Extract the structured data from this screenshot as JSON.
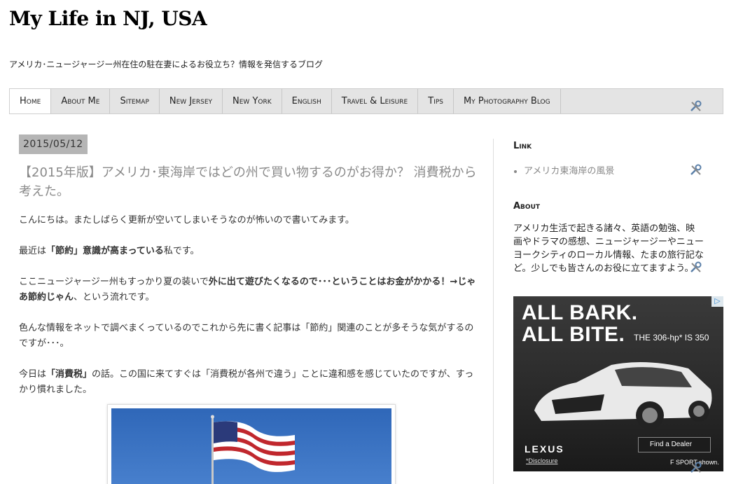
{
  "header": {
    "title": "My Life in NJ, USA",
    "description": "アメリカ･ニュージャージー州在住の駐在妻によるお役立ち？情報を発信するブログ"
  },
  "nav": {
    "items": [
      {
        "label": "Home"
      },
      {
        "label": "About Me"
      },
      {
        "label": "Sitemap"
      },
      {
        "label": "New Jersey"
      },
      {
        "label": "New York"
      },
      {
        "label": "English"
      },
      {
        "label": "Travel & Leisure"
      },
      {
        "label": "Tips"
      },
      {
        "label": "My Photography Blog"
      }
    ]
  },
  "post": {
    "date": "2015/05/12",
    "title": "【2015年版】アメリカ･東海岸ではどの州で買い物するのがお得か？ 消費税から考えた。",
    "p1": "こんにちは。またしばらく更新が空いてしまいそうなのが怖いので書いてみます。",
    "p2_pre": "最近は",
    "p2_bold": "「節約」意識が高まっている",
    "p2_post": "私です。",
    "p3_pre": "ここニュージャージー州もすっかり夏の装いで",
    "p3_bold": "外に出て遊びたくなるので･･･ということはお金がかかる！→じゃあ節約じゃん",
    "p3_post": "、という流れです。",
    "p4": "色んな情報をネットで調べまくっているのでこれから先に書く記事は「節約」関連のことが多そうな気がするのですが･･･。",
    "p5_pre": "今日は",
    "p5_bold": "「消費税」",
    "p5_post": "の話。この国に来てすぐは「消費税が各州で違う」ことに違和感を感じていたのですが、すっかり慣れました。"
  },
  "sidebar": {
    "link_heading": "Link",
    "links": [
      {
        "label": "アメリカ東海岸の風景"
      }
    ],
    "about_heading": "About",
    "about_text": "アメリカ生活で起きる諸々、英語の勉強、映画やドラマの感想、ニュージャージーやニューヨークシティのローカル情報、たまの旅行記など。少しでも皆さんのお役に立てますよう。"
  },
  "ad": {
    "headline_1": "ALL BARK.",
    "headline_2": "ALL BITE.",
    "model": "THE 306-hp* IS 350",
    "brand": "LEXUS",
    "dealer_button": "Find a Dealer",
    "disclosure": "*Disclosure",
    "fsport": "F SPORT shown.",
    "choice": "▷"
  },
  "colors": {
    "nav_bg": "#e4e4e4",
    "title_gray": "#8a8a8a",
    "date_bg": "#b5b5b5"
  }
}
